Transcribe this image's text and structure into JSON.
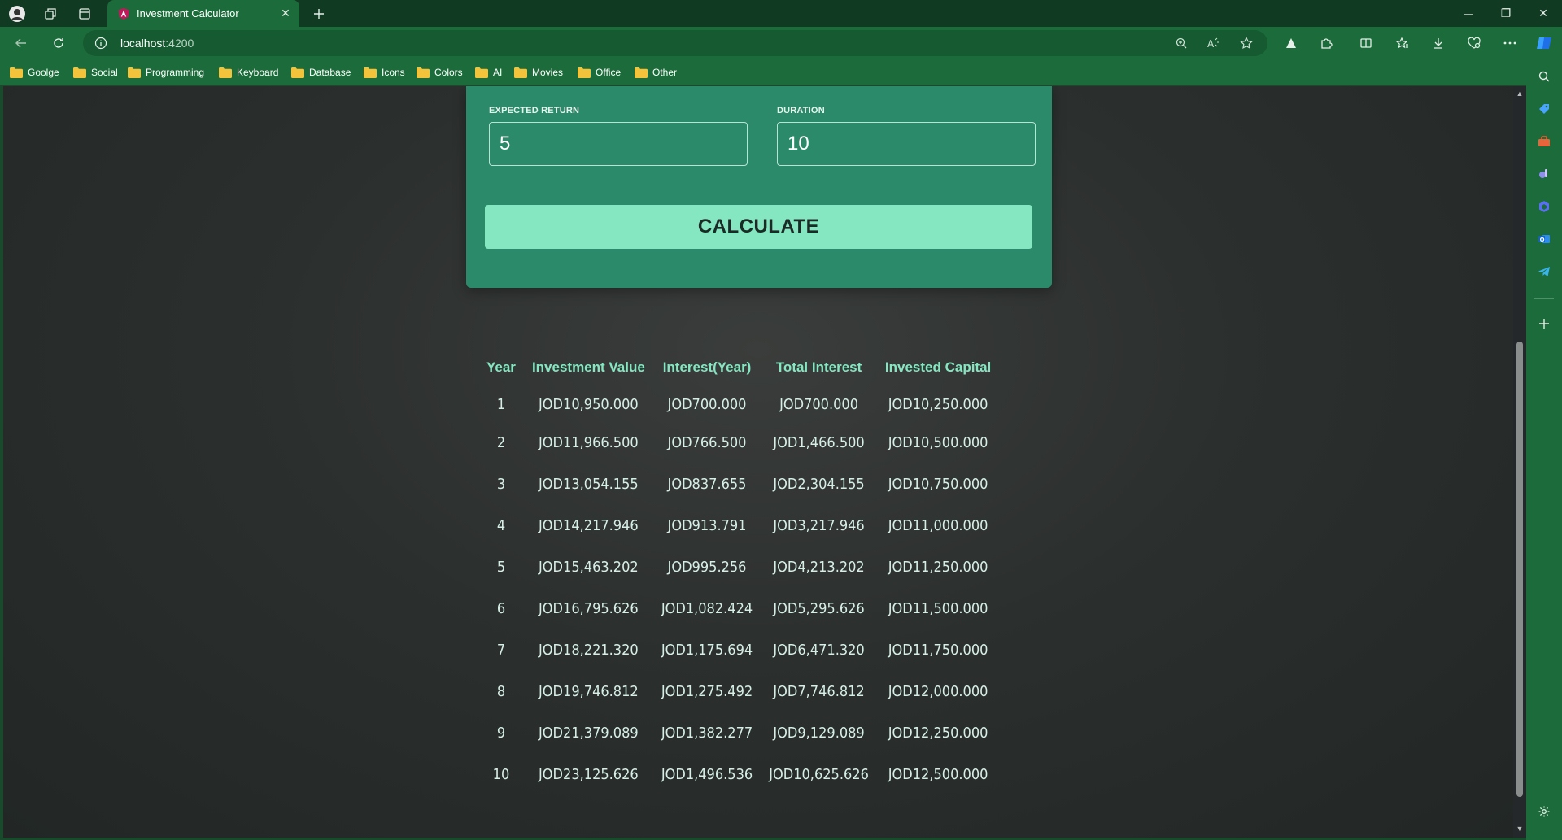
{
  "browser": {
    "tab": {
      "title": "Investment Calculator"
    },
    "address": {
      "url_host": "localhost",
      "url_port": ":4200"
    },
    "bookmarks": [
      "Goolge",
      "Social",
      "Programming",
      "Keyboard",
      "Database",
      "Icons",
      "Colors",
      "AI",
      "Movies",
      "Office",
      "Other"
    ]
  },
  "form": {
    "expected_return": {
      "label": "EXPECTED RETURN",
      "value": "5"
    },
    "duration": {
      "label": "DURATION",
      "value": "10"
    },
    "calculate_label": "CALCULATE"
  },
  "results": {
    "headers": [
      "Year",
      "Investment Value",
      "Interest(Year)",
      "Total Interest",
      "Invested Capital"
    ],
    "rows": [
      [
        "1",
        "JOD10,950.000",
        "JOD700.000",
        "JOD700.000",
        "JOD10,250.000"
      ],
      [
        "2",
        "JOD11,966.500",
        "JOD766.500",
        "JOD1,466.500",
        "JOD10,500.000"
      ],
      [
        "3",
        "JOD13,054.155",
        "JOD837.655",
        "JOD2,304.155",
        "JOD10,750.000"
      ],
      [
        "4",
        "JOD14,217.946",
        "JOD913.791",
        "JOD3,217.946",
        "JOD11,000.000"
      ],
      [
        "5",
        "JOD15,463.202",
        "JOD995.256",
        "JOD4,213.202",
        "JOD11,250.000"
      ],
      [
        "6",
        "JOD16,795.626",
        "JOD1,082.424",
        "JOD5,295.626",
        "JOD11,500.000"
      ],
      [
        "7",
        "JOD18,221.320",
        "JOD1,175.694",
        "JOD6,471.320",
        "JOD11,750.000"
      ],
      [
        "8",
        "JOD19,746.812",
        "JOD1,275.492",
        "JOD7,746.812",
        "JOD12,000.000"
      ],
      [
        "9",
        "JOD21,379.089",
        "JOD1,382.277",
        "JOD9,129.089",
        "JOD12,250.000"
      ],
      [
        "10",
        "JOD23,125.626",
        "JOD1,496.536",
        "JOD10,625.626",
        "JOD12,500.000"
      ]
    ]
  },
  "colors": {
    "accent": "#84e7c2",
    "card": "#2a8a6a",
    "chrome": "#1c6b3a"
  }
}
